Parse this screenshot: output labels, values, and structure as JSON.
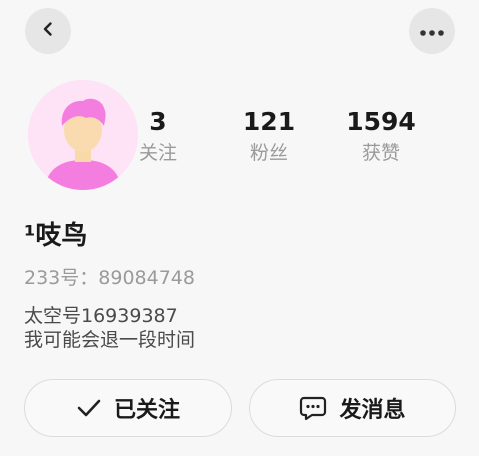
{
  "header": {
    "back_icon": "chevron-left-icon",
    "more_icon": "more-horizontal-icon"
  },
  "profile": {
    "avatar_icon": "default-avatar",
    "username": "¹吱鸟",
    "uid": "233号：89084748",
    "bio_lines": [
      "太空号16939387",
      "我可能会退一段时间"
    ]
  },
  "stats": {
    "following": {
      "value": "3",
      "label": "关注"
    },
    "fans": {
      "value": "121",
      "label": "粉丝"
    },
    "likes": {
      "value": "1594",
      "label": "获赞"
    }
  },
  "actions": {
    "follow_label": "已关注",
    "follow_icon": "check-icon",
    "message_label": "发消息",
    "message_icon": "chat-bubble-icon"
  },
  "colors": {
    "background": "#f7f7f7",
    "avatar_bg": "#fde3f5",
    "avatar_accent": "#f47ee0",
    "muted_text": "#9a9a9a"
  }
}
